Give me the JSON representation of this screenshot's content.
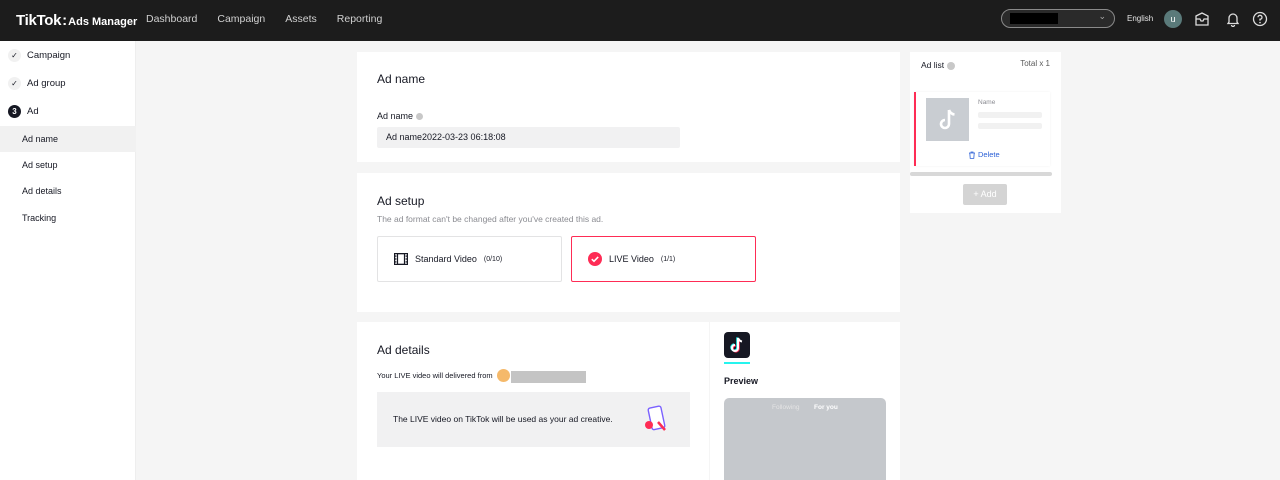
{
  "brand": {
    "name": "TikTok",
    "separator": ":",
    "product": "Ads Manager"
  },
  "nav": [
    "Dashboard",
    "Campaign",
    "Assets",
    "Reporting"
  ],
  "header": {
    "language": "English",
    "avatar_initial": "u"
  },
  "sidebar": {
    "steps": [
      {
        "label": "Campaign",
        "marker": "✓"
      },
      {
        "label": "Ad group",
        "marker": "✓"
      },
      {
        "label": "Ad",
        "marker": "3"
      }
    ],
    "sub_items": [
      "Ad name",
      "Ad setup",
      "Ad details",
      "Tracking"
    ]
  },
  "ad_name": {
    "title": "Ad name",
    "field_label": "Ad name",
    "value": "Ad name2022-03-23 06:18:08"
  },
  "ad_setup": {
    "title": "Ad setup",
    "hint": "The ad format can't be changed after you've created this ad.",
    "options": [
      {
        "label": "Standard Video",
        "count": "(0/10)"
      },
      {
        "label": "LIVE Video",
        "count": "(1/1)"
      }
    ]
  },
  "ad_details": {
    "title": "Ad details",
    "from_text": "Your LIVE video will delivered from",
    "info_text": "The LIVE video on TikTok will be used as your ad creative."
  },
  "preview": {
    "label": "Preview",
    "tab_following": "Following",
    "tab_foryou": "For you"
  },
  "ad_list": {
    "title": "Ad list",
    "total": "Total x 1",
    "item_name_label": "Name",
    "delete_label": "Delete",
    "add_label": "+ Add"
  },
  "colors": {
    "accent": "#fe2c55",
    "topbar": "#1c1c1c",
    "text": "#161823"
  }
}
